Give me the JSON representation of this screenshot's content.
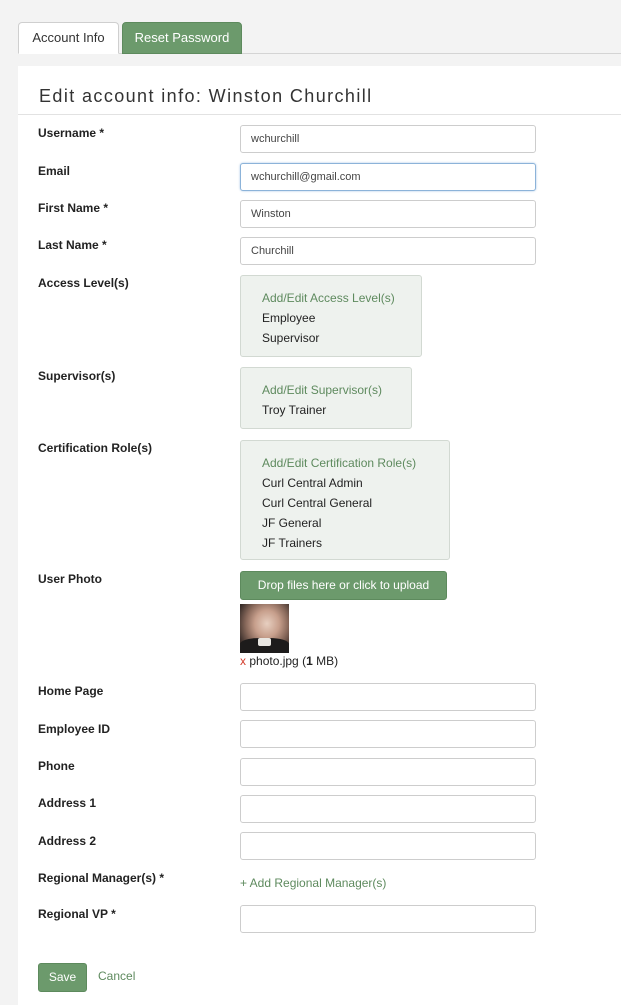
{
  "tabs": [
    {
      "label": "Account Info"
    },
    {
      "label": "Reset Password"
    }
  ],
  "heading": "Edit account info: Winston Churchill",
  "fields": {
    "username": {
      "label": "Username *",
      "value": "wchurchill"
    },
    "email": {
      "label": "Email",
      "value": "wchurchill@gmail.com"
    },
    "first_name": {
      "label": "First Name *",
      "value": "Winston"
    },
    "last_name": {
      "label": "Last Name *",
      "value": "Churchill"
    },
    "home_page": {
      "label": "Home Page",
      "value": ""
    },
    "employee_id": {
      "label": "Employee ID",
      "value": ""
    },
    "phone": {
      "label": "Phone",
      "value": ""
    },
    "address1": {
      "label": "Address 1",
      "value": ""
    },
    "address2": {
      "label": "Address 2",
      "value": ""
    },
    "regional_vp": {
      "label": "Regional VP *",
      "value": ""
    }
  },
  "access_levels": {
    "label": "Access Level(s)",
    "add_label": "Add/Edit Access Level(s)",
    "items": [
      "Employee",
      "Supervisor"
    ]
  },
  "supervisors": {
    "label": "Supervisor(s)",
    "add_label": "Add/Edit Supervisor(s)",
    "items": [
      "Troy Trainer"
    ]
  },
  "cert_roles": {
    "label": "Certification Role(s)",
    "add_label": "Add/Edit Certification Role(s)",
    "items": [
      "Curl Central Admin",
      "Curl Central General",
      "JF General",
      "JF Trainers"
    ]
  },
  "user_photo": {
    "label": "User Photo",
    "upload_label": "Drop files here or click to upload",
    "remove_symbol": "x",
    "file_name": "photo.jpg",
    "file_size_num": "1",
    "file_size_unit": "MB"
  },
  "regional_managers": {
    "label": "Regional Manager(s) *",
    "add_label": "+ Add Regional Manager(s)"
  },
  "actions": {
    "save": "Save",
    "cancel": "Cancel"
  },
  "colors": {
    "accent_green": "#6c9a6c",
    "link_green": "#5e8a5e",
    "box_bg": "#eef2ee",
    "remove_red": "#d23c2c"
  }
}
